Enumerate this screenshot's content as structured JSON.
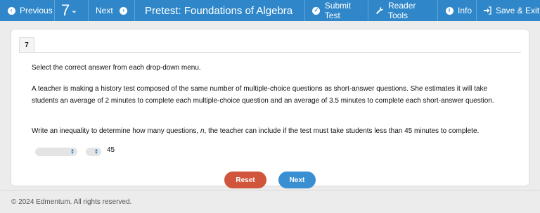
{
  "toolbar": {
    "previous_label": "Previous",
    "question_number": "7",
    "next_label": "Next",
    "title": "Pretest: Foundations of Algebra",
    "submit_label": "Submit Test",
    "reader_label": "Reader Tools",
    "info_label": "Info",
    "save_label": "Save & Exit",
    "bar_color": "#2f87c9"
  },
  "question": {
    "number": "7",
    "instruction": "Select the correct answer from each drop-down menu.",
    "paragraph1": "A teacher is making a history test composed of the same number of multiple-choice questions as short-answer questions. She estimates it will take students an average of 2 minutes to complete each multiple-choice question and an average of 3.5 minutes to complete each short-answer question.",
    "paragraph2_pre": "Write an inequality to determine how many questions, ",
    "paragraph2_var": "n",
    "paragraph2_post": ", the teacher can include if the test must take students less than 45 minutes to complete.",
    "dropdown1_value": "",
    "dropdown2_value": "",
    "constant": "45"
  },
  "buttons": {
    "reset_label": "Reset",
    "next_label": "Next",
    "reset_color": "#d1553c",
    "next_color": "#3a8fd3"
  },
  "footer": {
    "copyright": "© 2024 Edmentum. All rights reserved."
  }
}
